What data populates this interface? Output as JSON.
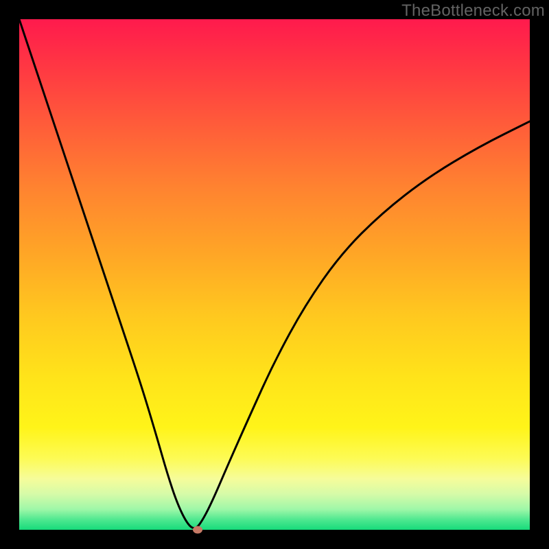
{
  "watermark": "TheBottleneck.com",
  "colors": {
    "curve_stroke": "#000000",
    "dot_fill": "#c77a66",
    "frame_bg": "#000000"
  },
  "chart_data": {
    "type": "line",
    "title": "",
    "xlabel": "",
    "ylabel": "",
    "xlim": [
      0,
      100
    ],
    "ylim": [
      0,
      100
    ],
    "annotations": [
      {
        "name": "minimum-dot",
        "x": 35,
        "y": 0
      }
    ],
    "series": [
      {
        "name": "bottleneck-curve",
        "x": [
          0,
          4,
          8,
          12,
          16,
          20,
          24,
          27,
          29,
          31,
          33,
          34.5,
          36,
          38,
          41,
          45,
          50,
          56,
          63,
          71,
          80,
          90,
          100
        ],
        "values": [
          100,
          88,
          76,
          64,
          52,
          40,
          28,
          18,
          11,
          5,
          1,
          0,
          2,
          6,
          13,
          22,
          33,
          44,
          54,
          62,
          69,
          75,
          80
        ]
      }
    ]
  }
}
